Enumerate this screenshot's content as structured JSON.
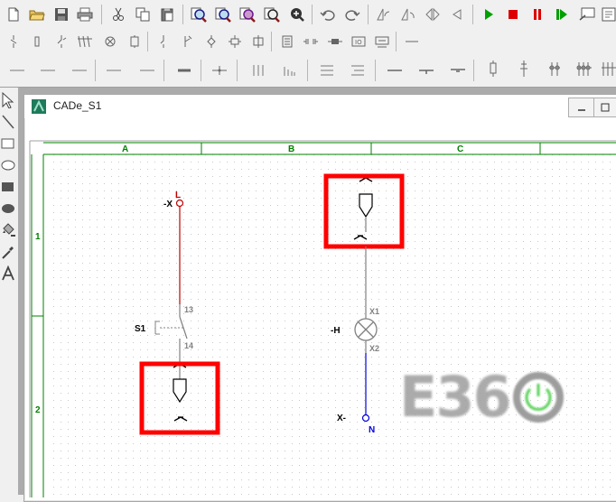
{
  "window": {
    "title": "CADe_S1"
  },
  "toolbars": {
    "row1": [
      "new-document",
      "open-folder",
      "save",
      "print",
      "cut",
      "copy",
      "paste",
      "zoom-in",
      "zoom-out",
      "zoom-fit",
      "zoom-window",
      "zoom-pan",
      "undo",
      "redo",
      "rotate-left",
      "rotate-right",
      "mirror",
      "run-simulation",
      "stop-simulation",
      "pause-simulation",
      "step-simulation",
      "window-list",
      "help"
    ],
    "row2": [
      "contact-no",
      "contact-nc",
      "switch",
      "multi-contact",
      "coil",
      "relay",
      "terminal",
      "fuse",
      "diode",
      "junction",
      "box",
      "resistor",
      "transistor",
      "ground",
      "connector",
      "cable",
      "wire-break"
    ],
    "row3": [
      "line-thin",
      "line-medium",
      "line-thick",
      "bus",
      "bus-bold",
      "wire-bold",
      "cross",
      "three-parallel",
      "bars",
      "list-align",
      "list-indent",
      "horizontal-line",
      "line-mark",
      "line-tee",
      "pot-vertical",
      "pot-horizontal",
      "multi-pot",
      "multi-pot-2",
      "multi-pot-3"
    ],
    "left": [
      "select-arrow",
      "line-tool",
      "rectangle-tool",
      "ellipse-tool",
      "filled-rectangle-tool",
      "filled-ellipse-tool",
      "fill-bucket-tool",
      "eyedropper-tool",
      "text-tool"
    ]
  },
  "frame": {
    "columns": [
      "A",
      "B",
      "C"
    ],
    "rows": [
      "1",
      "2"
    ]
  },
  "components": {
    "terminal_top": {
      "device": "-X",
      "pin": "L"
    },
    "switch": {
      "device": "S1",
      "pin_top": "13",
      "pin_bottom": "14"
    },
    "lamp": {
      "device": "-H",
      "pin_top": "X1",
      "pin_bottom": "X2"
    },
    "terminal_bottom": {
      "device": "X-",
      "pin": "N"
    }
  },
  "highlights": [
    "plug-connector-top-highlight",
    "plug-connector-bottom-highlight"
  ],
  "logo": {
    "text": "E36"
  },
  "colors": {
    "frame_green": "#008000",
    "wire_red": "#c00000",
    "wire_blue": "#0000dd",
    "wire_gray": "#808080",
    "highlight_red": "#ff0000",
    "play_green": "#00a000",
    "stop_red": "#dd0000",
    "logo_green": "#56d056"
  }
}
